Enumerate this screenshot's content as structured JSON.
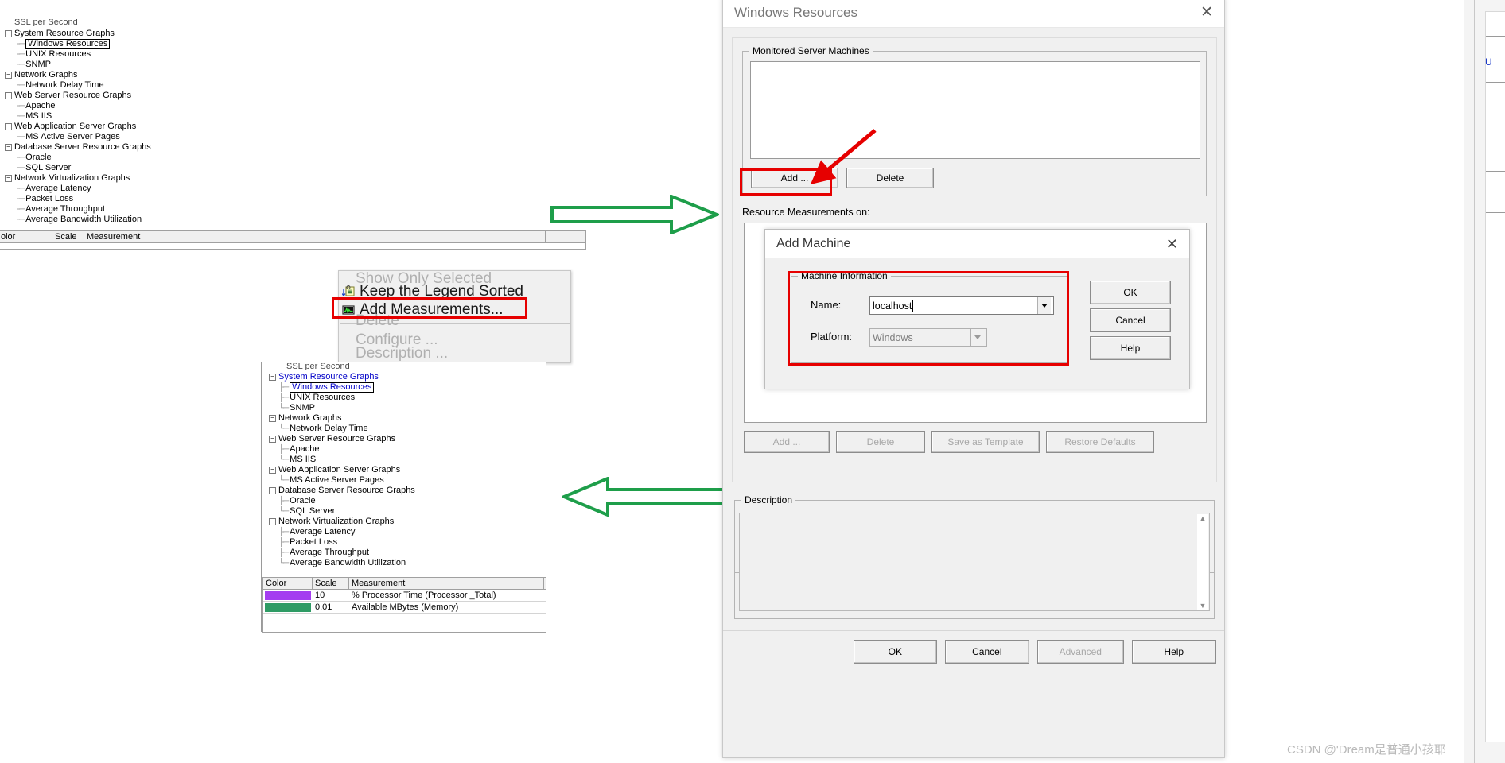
{
  "tree_top": {
    "partial_top_item": "SSL per Second",
    "items": [
      {
        "label": "System Resource Graphs",
        "level": 0,
        "expandable": true
      },
      {
        "label": "Windows Resources",
        "level": 1,
        "selected": true
      },
      {
        "label": "UNIX Resources",
        "level": 1
      },
      {
        "label": "SNMP",
        "level": 1,
        "last": true
      },
      {
        "label": "Network Graphs",
        "level": 0,
        "expandable": true
      },
      {
        "label": "Network Delay Time",
        "level": 1,
        "last": true
      },
      {
        "label": "Web Server Resource Graphs",
        "level": 0,
        "expandable": true
      },
      {
        "label": "Apache",
        "level": 1
      },
      {
        "label": "MS IIS",
        "level": 1,
        "last": true
      },
      {
        "label": "Web Application Server Graphs",
        "level": 0,
        "expandable": true
      },
      {
        "label": "MS Active Server Pages",
        "level": 1,
        "last": true
      },
      {
        "label": "Database Server Resource Graphs",
        "level": 0,
        "expandable": true
      },
      {
        "label": "Oracle",
        "level": 1
      },
      {
        "label": "SQL Server",
        "level": 1,
        "last": true
      },
      {
        "label": "Network Virtualization Graphs",
        "level": 0,
        "expandable": true
      },
      {
        "label": "Average Latency",
        "level": 1
      },
      {
        "label": "Packet Loss",
        "level": 1
      },
      {
        "label": "Average Throughput",
        "level": 1
      },
      {
        "label": "Average Bandwidth Utilization",
        "level": 1,
        "last": true
      }
    ]
  },
  "legend_top": {
    "columns": [
      "olor",
      "Scale",
      "Measurement"
    ],
    "rows": []
  },
  "context_menu": {
    "items": [
      {
        "label": "Show Only Selected",
        "enabled": false,
        "icon": null
      },
      {
        "label": "Keep the Legend Sorted",
        "enabled": true,
        "icon": "sort-legend-icon"
      },
      {
        "label": "Add Measurements...",
        "enabled": true,
        "icon": "add-measurement-icon",
        "highlighted": true
      },
      {
        "label": "Delete",
        "enabled": false,
        "icon": null
      },
      {
        "label": "Configure ...",
        "enabled": false,
        "icon": null
      },
      {
        "label": "Description ...",
        "enabled": false,
        "icon": null
      }
    ]
  },
  "tree_bottom": {
    "partial_top_item": "SSL per Second",
    "items": [
      {
        "label": "System Resource Graphs",
        "level": 0,
        "expandable": true,
        "blue": true
      },
      {
        "label": "Windows Resources",
        "level": 1,
        "selected": true,
        "blue": true
      },
      {
        "label": "UNIX Resources",
        "level": 1
      },
      {
        "label": "SNMP",
        "level": 1,
        "last": true
      },
      {
        "label": "Network Graphs",
        "level": 0,
        "expandable": true
      },
      {
        "label": "Network Delay Time",
        "level": 1,
        "last": true
      },
      {
        "label": "Web Server Resource Graphs",
        "level": 0,
        "expandable": true
      },
      {
        "label": "Apache",
        "level": 1
      },
      {
        "label": "MS IIS",
        "level": 1,
        "last": true
      },
      {
        "label": "Web Application Server Graphs",
        "level": 0,
        "expandable": true
      },
      {
        "label": "MS Active Server Pages",
        "level": 1,
        "last": true
      },
      {
        "label": "Database Server Resource Graphs",
        "level": 0,
        "expandable": true
      },
      {
        "label": "Oracle",
        "level": 1
      },
      {
        "label": "SQL Server",
        "level": 1,
        "last": true
      },
      {
        "label": "Network Virtualization Graphs",
        "level": 0,
        "expandable": true
      },
      {
        "label": "Average Latency",
        "level": 1
      },
      {
        "label": "Packet Loss",
        "level": 1
      },
      {
        "label": "Average Throughput",
        "level": 1
      },
      {
        "label": "Average Bandwidth Utilization",
        "level": 1,
        "last": true
      }
    ]
  },
  "legend_bottom": {
    "columns": [
      "Color",
      "Scale",
      "Measurement"
    ],
    "rows": [
      {
        "color": "#a43ef0",
        "scale": "10",
        "measurement": "% Processor Time (Processor _Total)"
      },
      {
        "color": "#2e9b64",
        "scale": "0.01",
        "measurement": "Available MBytes (Memory)"
      }
    ]
  },
  "windows_resources_dialog": {
    "title": "Windows Resources",
    "close_icon": "close-icon",
    "monitored_group_title": "Monitored Server Machines",
    "machine_list_items": [],
    "add_button": "Add ...",
    "delete_button": "Delete",
    "resource_measurements_label": "Resource Measurements on:",
    "measurement_buttons": [
      {
        "label": "Add ...",
        "enabled": false
      },
      {
        "label": "Delete",
        "enabled": false
      },
      {
        "label": "Save as Template",
        "enabled": false
      },
      {
        "label": "Restore Defaults",
        "enabled": false
      }
    ],
    "description_group_title": "Description",
    "description_text": "",
    "footer_buttons": [
      {
        "label": "OK",
        "enabled": true
      },
      {
        "label": "Cancel",
        "enabled": true
      },
      {
        "label": "Advanced",
        "enabled": false
      },
      {
        "label": "Help",
        "enabled": true
      }
    ]
  },
  "add_machine_dialog": {
    "title": "Add Machine",
    "close_icon": "close-icon",
    "group_title": "Machine Information",
    "name_label": "Name:",
    "name_value": "localhost",
    "name_placeholder": "",
    "platform_label": "Platform:",
    "platform_value": "Windows",
    "buttons": [
      {
        "label": "OK"
      },
      {
        "label": "Cancel"
      },
      {
        "label": "Help"
      }
    ]
  },
  "annotations": {
    "arrow_right_label": "flow-arrow-right",
    "arrow_left_label": "flow-arrow-left",
    "red_pointer_label": "red-pointer-arrow",
    "highlight_color": "#e60000",
    "flow_arrow_color": "#1e9e4a"
  },
  "watermark": "CSDN @'Dream是普通小孩耶"
}
